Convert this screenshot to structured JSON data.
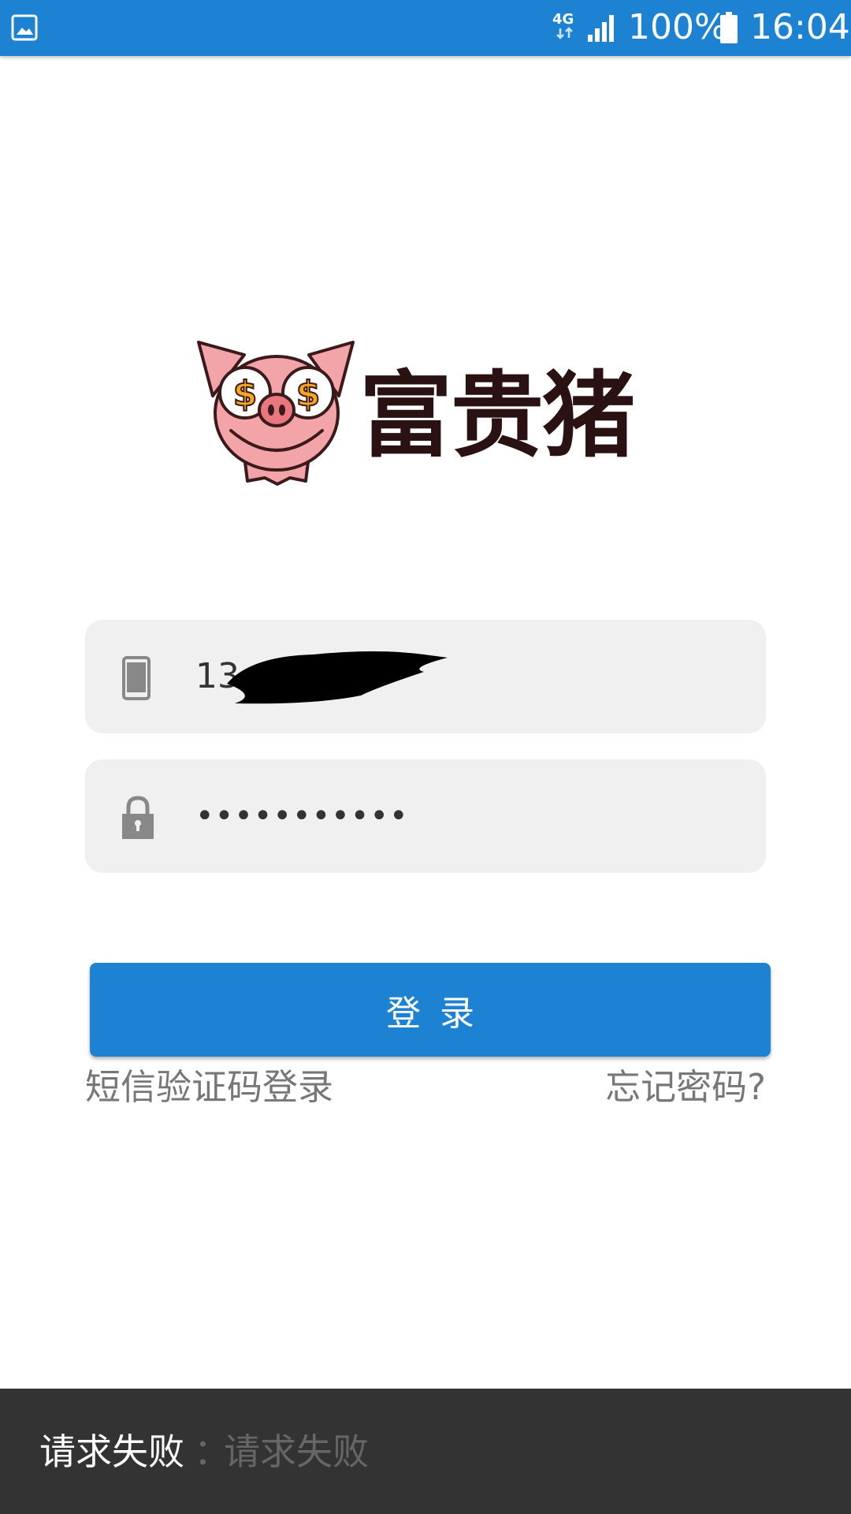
{
  "status_bar": {
    "network": "4G",
    "battery": "100%",
    "time": "16:04"
  },
  "logo": {
    "brand_name": "富贵猪",
    "pig_eye_symbol": "$"
  },
  "login_form": {
    "phone": {
      "icon": "phone-icon",
      "value": "13",
      "value_note_hidden": ""
    },
    "password": {
      "icon": "lock-icon",
      "value": "•••••••••••"
    },
    "login_button_label": "登录",
    "sms_login_link": "短信验证码登录",
    "forgot_password_link": "忘记密码?"
  },
  "toast": {
    "title": "请求失败",
    "separator": "：",
    "detail": "请求失败"
  },
  "colors": {
    "primary": "#1e82d2",
    "field_bg": "#f0f0f0",
    "toast_bg": "#333333",
    "link_text": "#777777",
    "logo_text": "#2a1212"
  }
}
